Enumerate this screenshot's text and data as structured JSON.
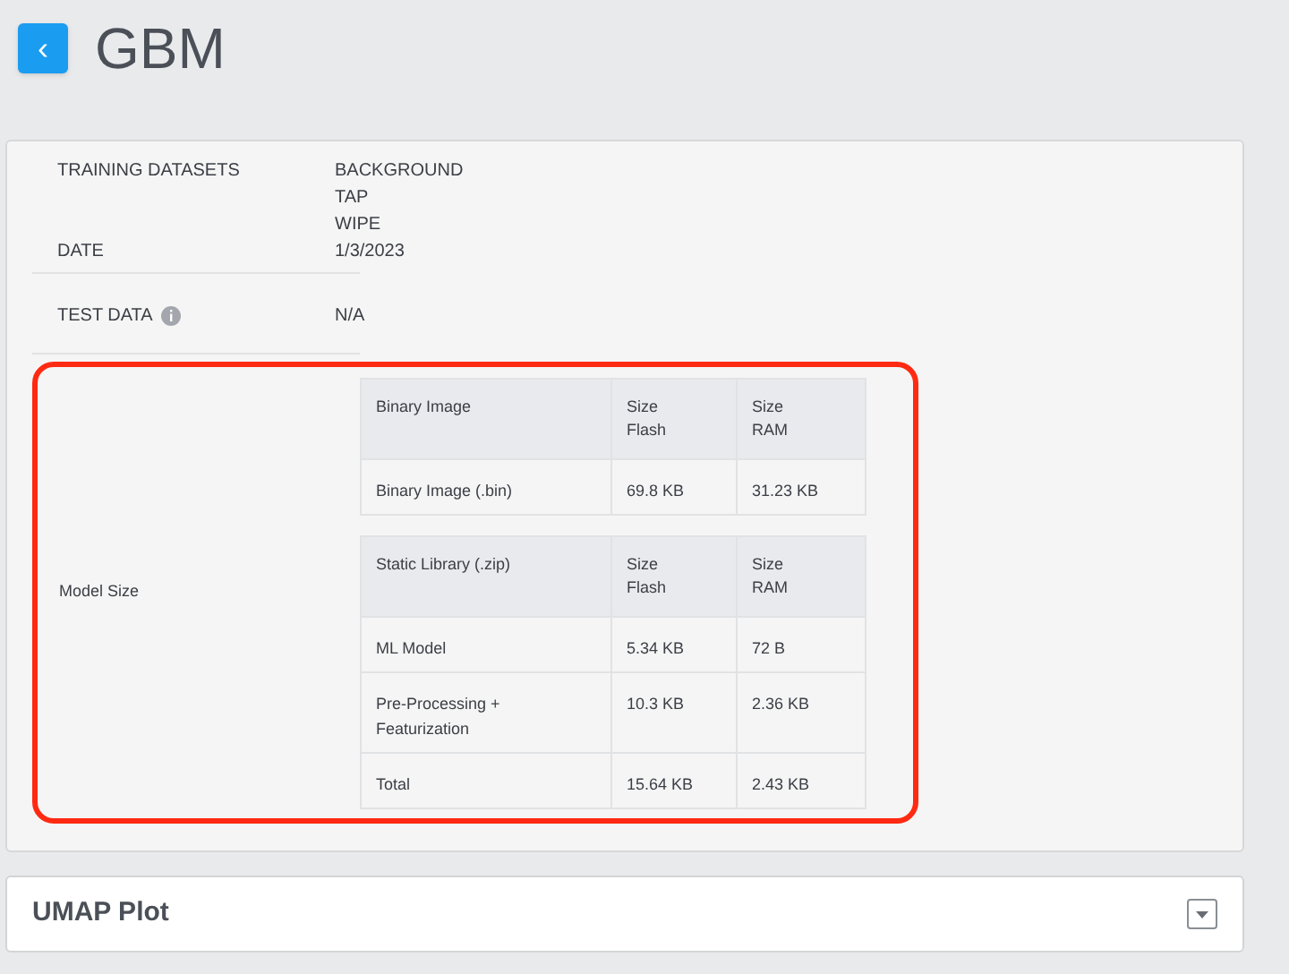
{
  "header": {
    "back_icon": "‹",
    "title": "GBM"
  },
  "details": [
    {
      "kind": "list",
      "label": "TRAINING DATASETS",
      "values": [
        "BACKGROUND",
        "TAP",
        "WIPE"
      ]
    },
    {
      "kind": "plain",
      "label": "DATE",
      "values": [
        "1/3/2023"
      ]
    },
    {
      "kind": "info",
      "label": "TEST DATA",
      "values": [
        "N/A"
      ]
    }
  ],
  "model_size": {
    "label": "Model Size",
    "highlighted": true,
    "tables": [
      {
        "columns": [
          "Binary Image",
          "Size\nFlash",
          "Size\nRAM"
        ],
        "rows": [
          [
            "Binary Image (.bin)",
            "69.8 KB",
            "31.23 KB"
          ]
        ]
      },
      {
        "columns": [
          "Static Library (.zip)",
          "Size\nFlash",
          "Size\nRAM"
        ],
        "rows": [
          [
            "ML Model",
            "5.34 KB",
            "72 B"
          ],
          [
            "Pre-Processing +\nFeaturization",
            "10.3 KB",
            "2.36 KB"
          ],
          [
            "Total",
            "15.64 KB",
            "2.43 KB"
          ]
        ]
      }
    ]
  },
  "section": {
    "title": "UMAP Plot"
  }
}
